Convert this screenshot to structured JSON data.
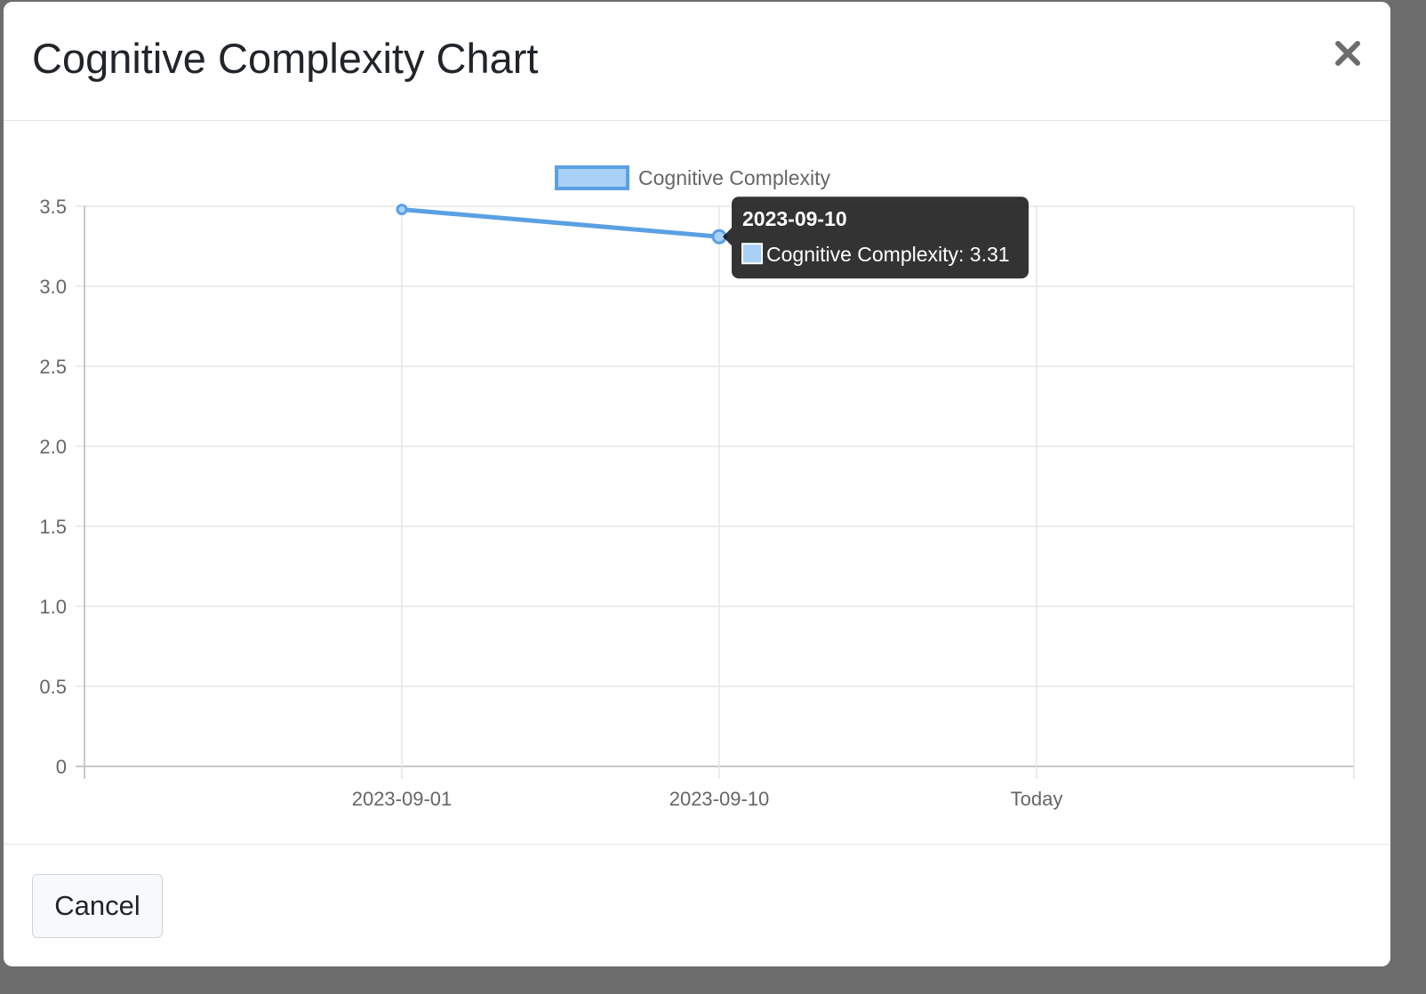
{
  "modal": {
    "title": "Cognitive Complexity Chart",
    "close_icon": "close-icon",
    "cancel_label": "Cancel"
  },
  "colors": {
    "series_line": "#5aa0e4",
    "series_fill": "#a9d0f5",
    "grid": "#e5e5e5",
    "tooltip_bg": "#000000"
  },
  "chart_data": {
    "type": "line",
    "x": [
      "2023-09-01",
      "2023-09-10",
      "Today"
    ],
    "series": [
      {
        "name": "Cognitive Complexity",
        "values": [
          3.48,
          3.31,
          null
        ]
      }
    ],
    "yticks": [
      "0",
      "0.5",
      "1.0",
      "1.5",
      "2.0",
      "2.5",
      "3.0",
      "3.5"
    ],
    "ylim": [
      0,
      3.5
    ],
    "legend_position": "top",
    "grid": true,
    "tooltip": {
      "title": "2023-09-10",
      "label": "Cognitive Complexity: 3.31"
    }
  }
}
